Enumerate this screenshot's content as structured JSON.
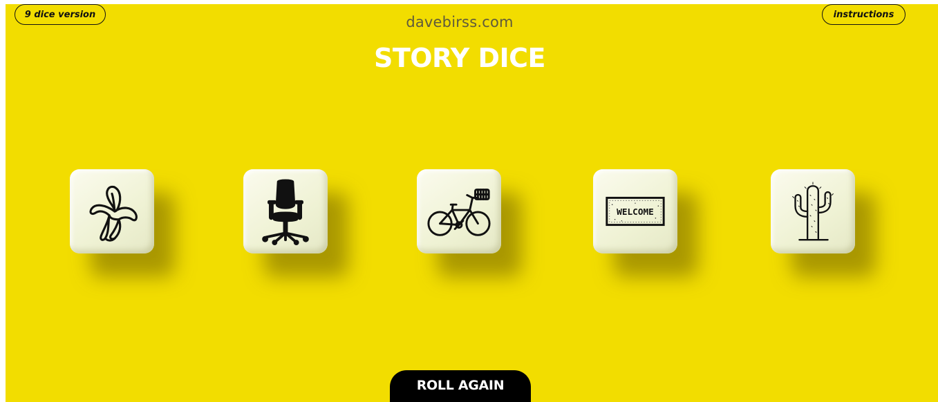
{
  "nav": {
    "left_button": "9 dice version",
    "right_button": "instructions"
  },
  "header": {
    "site": "davebirss.com",
    "title": "STORY DICE"
  },
  "dice": [
    {
      "icon": "banana-icon"
    },
    {
      "icon": "office-chair-icon"
    },
    {
      "icon": "bicycle-icon"
    },
    {
      "icon": "welcome-mat-icon",
      "text": "WELCOME"
    },
    {
      "icon": "cactus-icon"
    }
  ],
  "action": {
    "roll_label": "ROLL AGAIN"
  },
  "colors": {
    "background": "#f2dd00",
    "die_face": "#f4f6de",
    "button": "#000000",
    "title": "#ffffff"
  }
}
